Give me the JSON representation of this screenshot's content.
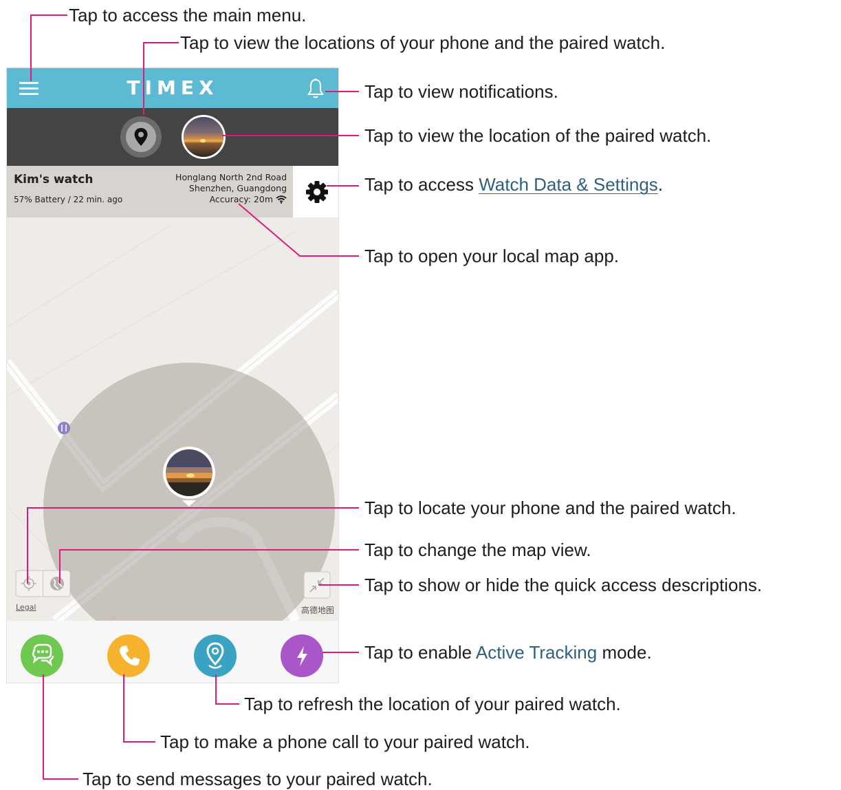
{
  "app": {
    "logo": "TIMEX",
    "watch_name": "Kim's watch",
    "battery_status": "57% Battery / 22 min. ago",
    "address_line1": "Honglang North 2nd Road",
    "address_line2": "Shenzhen, Guangdong",
    "accuracy": "Accuracy: 20m",
    "map_legal": "Legal",
    "map_provider": "高德地图",
    "icons": {
      "menu": "hamburger-menu-icon",
      "notifications": "bell-icon",
      "locate_both": "location-pin-icon",
      "watch_avatar": "watch-avatar-photo",
      "settings": "gear-icon",
      "locate": "crosshair-icon",
      "map_view": "globe-icon",
      "descriptions_toggle": "collapse-arrows-icon",
      "poi": "restaurant-poi-icon",
      "messages": "chat-bubble-icon",
      "call": "phone-icon",
      "refresh_location": "location-pin-icon",
      "active_tracking": "lightning-bolt-icon"
    },
    "colors": {
      "header": "#5cbad2",
      "dark_bar": "#444444",
      "messages": "#6fc84f",
      "call": "#f7b22e",
      "refresh": "#3aa3c3",
      "active_tracking": "#a956c8",
      "annotation_line": "#e0197d",
      "link": "#2e5f7e"
    }
  },
  "annotations": {
    "main_menu": "Tap to access the main menu.",
    "view_locations": "Tap to view the locations of your phone and the paired watch.",
    "notifications": "Tap to view notifications.",
    "watch_location": "Tap to view the location of the paired watch.",
    "settings_prefix": "Tap to access ",
    "settings_link": "Watch Data & Settings",
    "settings_suffix": ".",
    "map_app": "Tap to open your local map app.",
    "locate": "Tap to locate your phone and the paired watch.",
    "map_view": "Tap to change the map view.",
    "quick_access": "Tap to show or hide the quick access descriptions.",
    "active_prefix": "Tap to enable ",
    "active_link": "Active Tracking",
    "active_suffix": " mode.",
    "refresh": "Tap to refresh the location of your paired watch.",
    "call": "Tap to make a phone call to your paired watch.",
    "messages": "Tap to send messages to your paired watch."
  }
}
